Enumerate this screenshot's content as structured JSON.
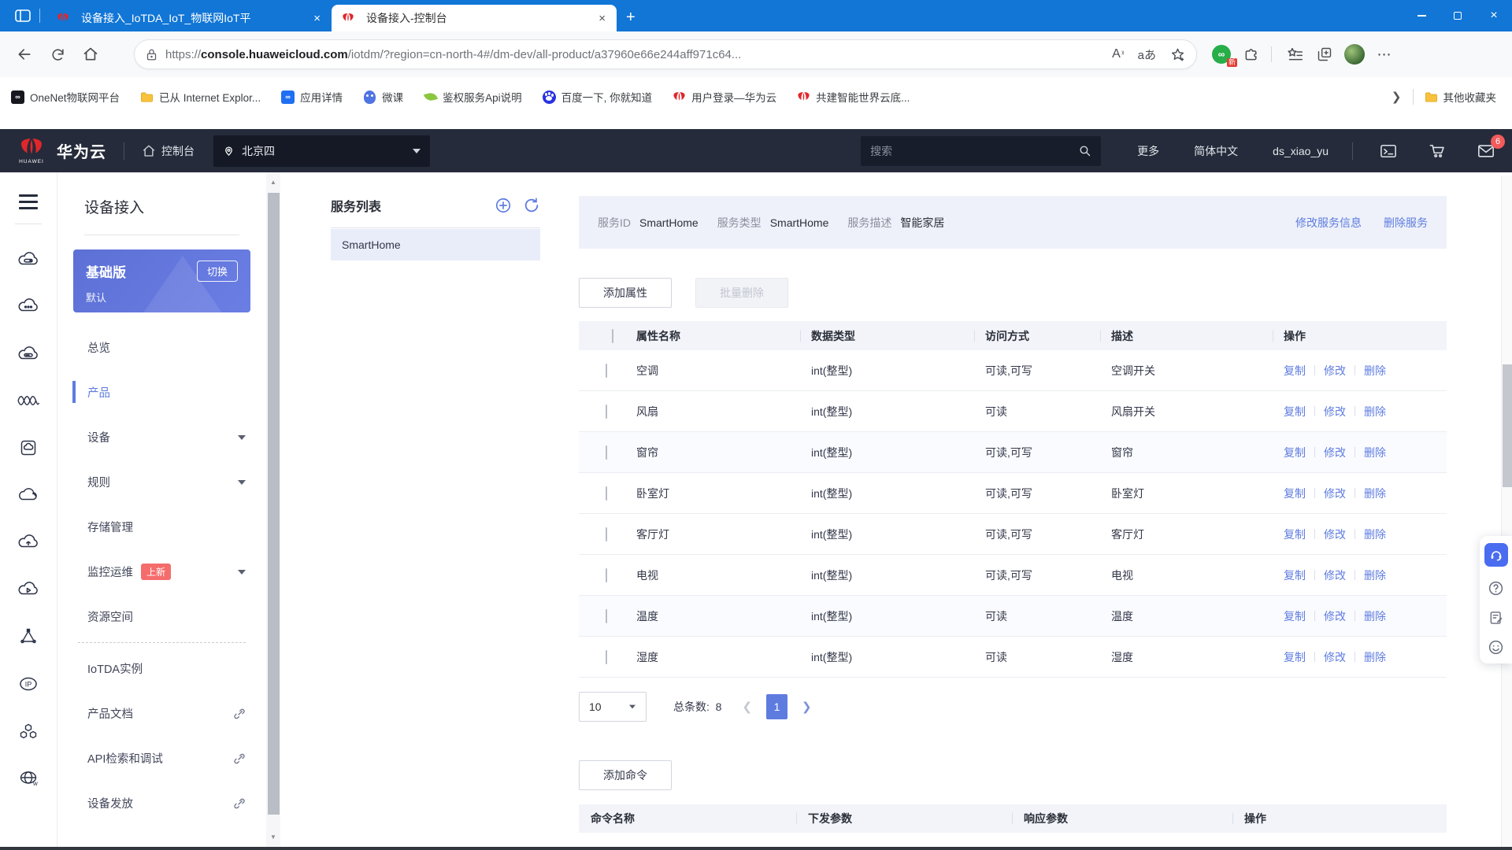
{
  "colors": {
    "accent": "#5e7ce0",
    "header_bg": "#252b3a",
    "titlebar_blue": "#1176d6",
    "badge_red": "#f56c6c"
  },
  "browser": {
    "tabs": [
      {
        "label": "设备接入_IoTDA_IoT_物联网IoT平"
      },
      {
        "label": "设备接入-控制台"
      }
    ],
    "new_tab": "+",
    "close_glyph": "×",
    "url": {
      "scheme": "https://",
      "domain": "console.huaweicloud.com",
      "path": "/iotdm/?region=cn-north-4#/dm-dev/all-product/a37960e66e244aff971c64..."
    },
    "reader_label": "A",
    "translate_label": "aあ",
    "new_flag": "新",
    "green_app_glyph": "∞",
    "bookmarks": [
      {
        "label": "OneNet物联网平台"
      },
      {
        "label": "已从 Internet Explor..."
      },
      {
        "label": "应用详情"
      },
      {
        "label": "微课"
      },
      {
        "label": "鉴权服务Api说明"
      },
      {
        "label": "百度一下, 你就知道"
      },
      {
        "label": "用户登录—华为云"
      },
      {
        "label": "共建智能世界云底..."
      }
    ],
    "bookmarks_overflow": "❯",
    "other_favorites": "其他收藏夹"
  },
  "header": {
    "logo_text": "HUAWEI",
    "brand": "华为云",
    "console": "控制台",
    "region": "北京四",
    "search_placeholder": "搜索",
    "more": "更多",
    "language": "简体中文",
    "username": "ds_xiao_yu",
    "mail_badge": "6"
  },
  "sidebar": {
    "title": "设备接入",
    "edition": {
      "name": "基础版",
      "switch_label": "切换",
      "instance": "默认"
    },
    "items": [
      {
        "label": "总览"
      },
      {
        "label": "产品",
        "active": true
      },
      {
        "label": "设备",
        "arrow": true
      },
      {
        "label": "规则",
        "arrow": true
      },
      {
        "label": "存储管理"
      },
      {
        "label": "监控运维",
        "badge": "上新",
        "arrow": true
      },
      {
        "label": "资源空间"
      },
      {
        "label": "IoTDA实例"
      },
      {
        "label": "产品文档",
        "external": true
      },
      {
        "label": "API检索和调试",
        "external": true
      },
      {
        "label": "设备发放",
        "external": true
      }
    ]
  },
  "service_list": {
    "title": "服务列表",
    "selected": "SmartHome",
    "items": [
      "SmartHome"
    ]
  },
  "service_info": {
    "id_label": "服务ID",
    "id_value": "SmartHome",
    "type_label": "服务类型",
    "type_value": "SmartHome",
    "desc_label": "服务描述",
    "desc_value": "智能家居",
    "edit_link": "修改服务信息",
    "delete_link": "删除服务"
  },
  "properties": {
    "add_button": "添加属性",
    "batch_delete_button": "批量删除",
    "columns": [
      "属性名称",
      "数据类型",
      "访问方式",
      "描述",
      "操作"
    ],
    "row_actions": [
      "复制",
      "修改",
      "删除"
    ],
    "rows": [
      {
        "name": "空调",
        "type": "int(整型)",
        "access": "可读,可写",
        "desc": "空调开关"
      },
      {
        "name": "风扇",
        "type": "int(整型)",
        "access": "可读",
        "desc": "风扇开关"
      },
      {
        "name": "窗帘",
        "type": "int(整型)",
        "access": "可读,可写",
        "desc": "窗帘"
      },
      {
        "name": "卧室灯",
        "type": "int(整型)",
        "access": "可读,可写",
        "desc": "卧室灯"
      },
      {
        "name": "客厅灯",
        "type": "int(整型)",
        "access": "可读,可写",
        "desc": "客厅灯"
      },
      {
        "name": "电视",
        "type": "int(整型)",
        "access": "可读,可写",
        "desc": "电视"
      },
      {
        "name": "温度",
        "type": "int(整型)",
        "access": "可读",
        "desc": "温度"
      },
      {
        "name": "湿度",
        "type": "int(整型)",
        "access": "可读",
        "desc": "湿度"
      }
    ],
    "pagination": {
      "page_size": "10",
      "total_label": "总条数:",
      "total": "8",
      "current_page": "1"
    }
  },
  "commands": {
    "add_button": "添加命令",
    "columns": [
      "命令名称",
      "下发参数",
      "响应参数",
      "操作"
    ]
  }
}
